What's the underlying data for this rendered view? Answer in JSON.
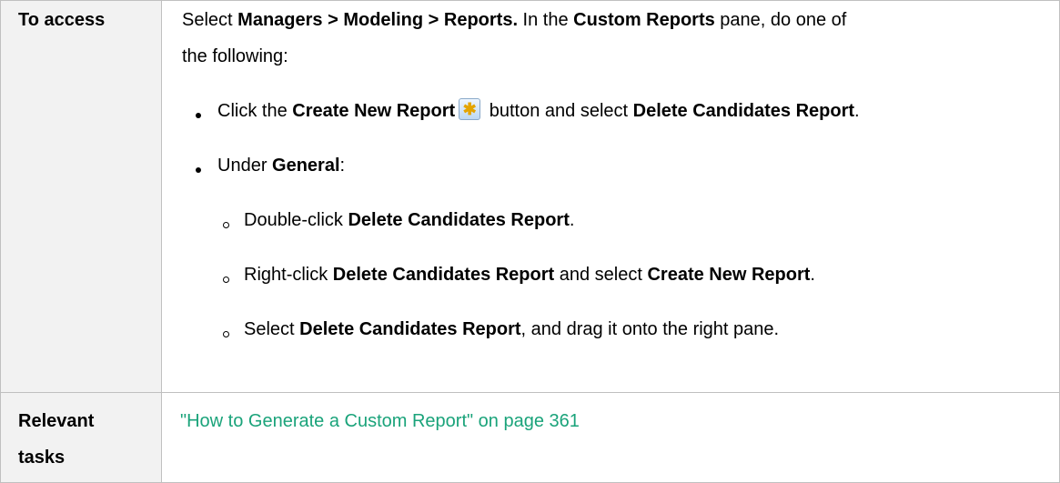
{
  "table": {
    "row_access": {
      "header": "To access",
      "intro": {
        "p1": "Select ",
        "b1": "Managers > Modeling > Reports.",
        "p2": " In the ",
        "b2": "Custom Reports",
        "p3": " pane, do one of",
        "line2": "the following:"
      },
      "bullet1": {
        "p1": "Click the ",
        "b1": "Create New Report",
        "icon": "create-new-report-icon",
        "p2": " button and select ",
        "b2": "Delete Candidates Report",
        "p3": "."
      },
      "bullet2": {
        "p1": "Under ",
        "b1": "General",
        "p2": ":"
      },
      "sub1": {
        "p1": "Double-click ",
        "b1": "Delete Candidates Report",
        "p2": "."
      },
      "sub2": {
        "p1": "Right-click ",
        "b1": "Delete Candidates Report",
        "p2": " and select ",
        "b2": "Create New Report",
        "p3": "."
      },
      "sub3": {
        "p1": "Select ",
        "b1": "Delete Candidates Report",
        "p2": ", and drag it onto the right pane."
      }
    },
    "row_tasks": {
      "header_line1": "Relevant",
      "header_line2": "tasks",
      "link_text": "\"How to Generate a Custom Report\" on page 361"
    }
  },
  "colors": {
    "link": "#1aa37a",
    "header_bg": "#f2f2f2",
    "border": "#c0c0c0"
  }
}
